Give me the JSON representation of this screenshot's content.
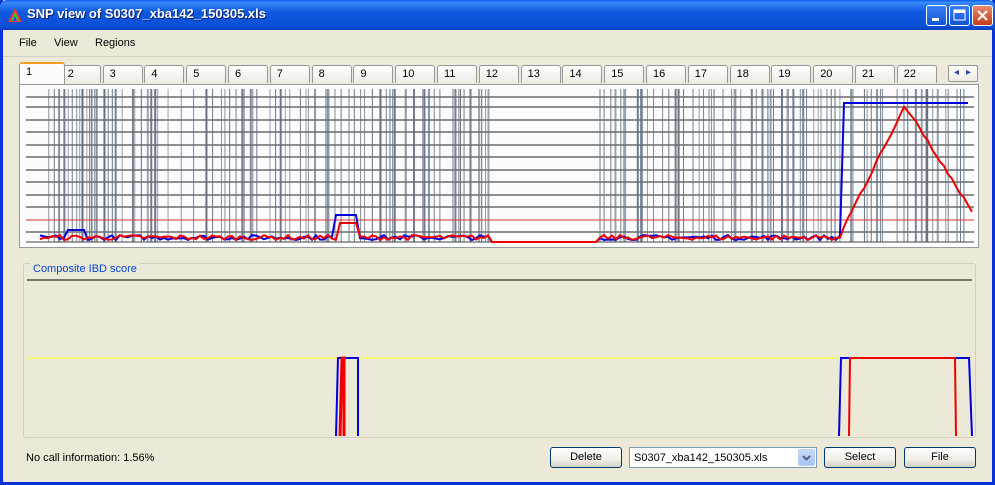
{
  "window": {
    "title": "SNP view of S0307_xba142_150305.xls",
    "controls": {
      "minimize": "_",
      "maximize": "□",
      "close": "✕"
    }
  },
  "menu": [
    "File",
    "View",
    "Regions"
  ],
  "tabs": [
    "1",
    "2",
    "3",
    "4",
    "5",
    "6",
    "7",
    "8",
    "9",
    "10",
    "11",
    "12",
    "13",
    "14",
    "15",
    "16",
    "17",
    "18",
    "19",
    "20",
    "21",
    "22"
  ],
  "active_tab": "1",
  "tab_scroll": {
    "left": "◂",
    "right": "▸"
  },
  "composite": {
    "label": "Composite IBD score"
  },
  "status": {
    "no_call": "No call information: 1.56%"
  },
  "buttons": {
    "delete": "Delete",
    "select": "Select",
    "file": "File"
  },
  "file_select": {
    "value": "S0307_xba142_150305.xls"
  },
  "colors": {
    "titlebar": "#0b4fd6",
    "blue_trace": "#0000dd",
    "red_trace": "#ee0000",
    "threshold": "#ffff00",
    "snp_bars": "#5f6e80"
  }
}
